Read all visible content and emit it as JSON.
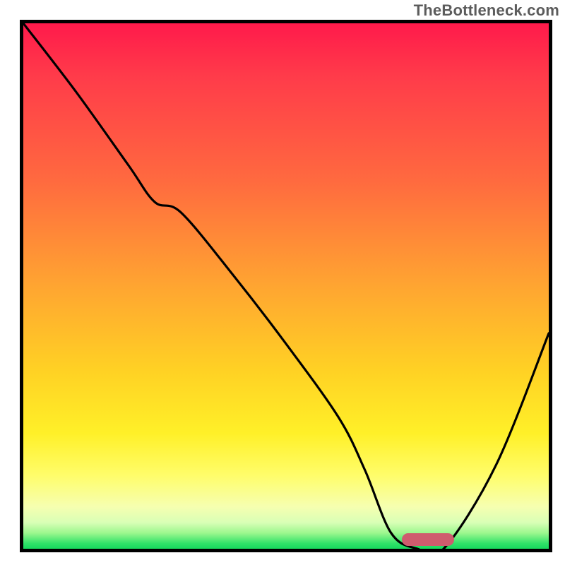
{
  "watermark": "TheBottleneck.com",
  "colors": {
    "frame_border": "#000000",
    "watermark_text": "#5c5c5c",
    "curve_stroke": "#000000",
    "bar": "#cf5c6e",
    "gradient_top": "#ff1a4b",
    "gradient_bottom": "#17d95e"
  },
  "chart_data": {
    "type": "line",
    "title": "",
    "xlabel": "",
    "ylabel": "",
    "xlim": [
      0,
      100
    ],
    "ylim": [
      0,
      100
    ],
    "grid": false,
    "legend": false,
    "annotations": [],
    "series": [
      {
        "name": "bottleneck-curve",
        "x": [
          0,
          10,
          20,
          25,
          30,
          40,
          50,
          60,
          65,
          70,
          75,
          80,
          90,
          100
        ],
        "y": [
          100,
          87,
          73,
          66,
          64,
          52,
          39,
          25,
          15,
          3,
          0,
          0,
          16,
          41
        ]
      }
    ],
    "marker": {
      "name": "optimal-range-bar",
      "x_start": 72,
      "x_end": 82,
      "y": 0
    },
    "background": "vertical-gradient red->yellow->green"
  }
}
